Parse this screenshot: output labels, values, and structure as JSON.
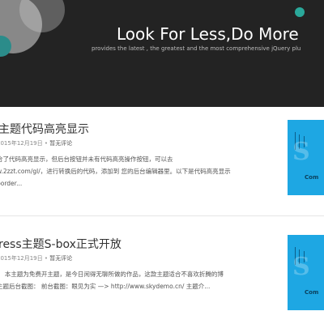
{
  "header": {
    "title": "Look For Less,Do More",
    "subtitle": "provides the latest , the greatest and the most comprehensive jQuery plu"
  },
  "posts": [
    {
      "title": "主题代码高亮显示",
      "date": "2015年12月19日",
      "separator": "•",
      "comments": "暂无评论",
      "excerpt": [
        "合了代码高亮显示，但后台按钮并未有代码高亮操作按钮，可以去",
        "w.2zzt.com/gl/，进行转换后的代码，添加到 您的后台编辑器里。以下是代码高亮显示",
        "border..."
      ],
      "thumb_text": "Com"
    },
    {
      "title": "ress主题S-box正式开放",
      "date": "2015年12月19日",
      "separator": "•",
      "comments": "暂无评论",
      "excerpt": [
        "： 本主题为免费开主题，是今日闲得无聊所做的作品，这款主题适合不喜欢折腾的博",
        "主题后台截图： 前台截图：眼见为实 —> http://www.skydemo.cn/ 主题介..."
      ],
      "thumb_text": "Com"
    }
  ]
}
